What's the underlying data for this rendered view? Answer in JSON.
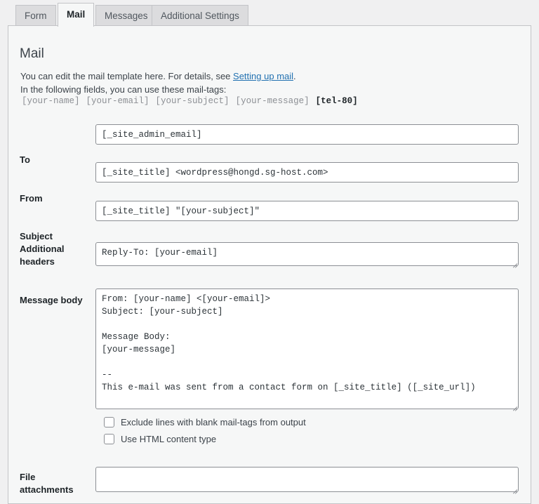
{
  "tabs": [
    {
      "label": "Form",
      "active": false
    },
    {
      "label": "Mail",
      "active": true
    },
    {
      "label": "Messages",
      "active": false
    },
    {
      "label": "Additional Settings",
      "active": false
    }
  ],
  "panel": {
    "title": "Mail",
    "description_prefix": "You can edit the mail template here. For details, see ",
    "description_link": "Setting up mail",
    "description_suffix": ".",
    "mailtags_intro": "In the following fields, you can use these mail-tags:",
    "mailtags": [
      {
        "text": "[your-name]",
        "highlight": false
      },
      {
        "text": "[your-email]",
        "highlight": false
      },
      {
        "text": "[your-subject]",
        "highlight": false
      },
      {
        "text": "[your-message]",
        "highlight": false
      },
      {
        "text": "[tel-80]",
        "highlight": true
      }
    ]
  },
  "fields": {
    "to": {
      "label": "To",
      "value": "[_site_admin_email]"
    },
    "from": {
      "label": "From",
      "value": "[_site_title] <wordpress@hongd.sg-host.com>"
    },
    "subject": {
      "label": "Subject",
      "value": "[_site_title] \"[your-subject]\""
    },
    "additional_headers": {
      "label": "Additional headers",
      "value": "Reply-To: [your-email]"
    },
    "message_body": {
      "label": "Message body",
      "value": "From: [your-name] <[your-email]>\nSubject: [your-subject]\n\nMessage Body:\n[your-message]\n\n--\nThis e-mail was sent from a contact form on [_site_title] ([_site_url])"
    },
    "file_attachments": {
      "label": "File attachments",
      "value": ""
    }
  },
  "checkboxes": [
    {
      "label": "Exclude lines with blank mail-tags from output",
      "checked": false
    },
    {
      "label": "Use HTML content type",
      "checked": false
    }
  ],
  "colors": {
    "accent_link": "#2271b1",
    "panel_bg": "#f6f7f7",
    "page_bg": "#f0f0f1",
    "border": "#c3c4c7",
    "field_border": "#8c8f94",
    "text": "#3c434a",
    "muted": "#8c8f94"
  }
}
